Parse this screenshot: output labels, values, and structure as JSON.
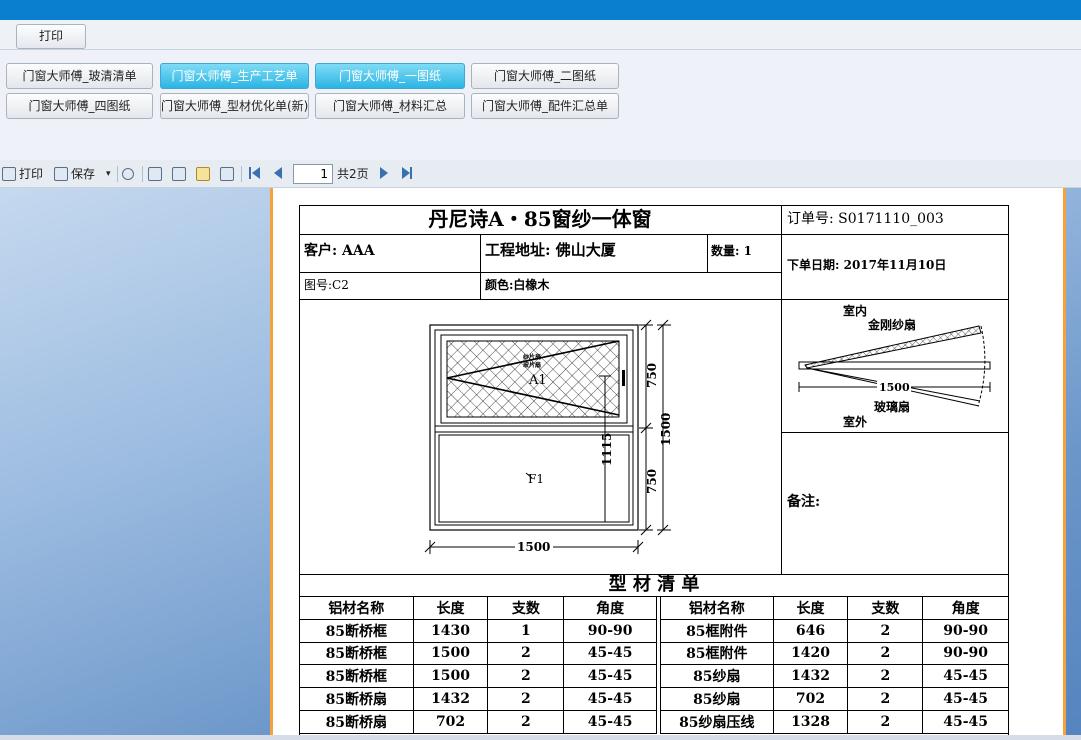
{
  "app": {
    "print_button": "打印"
  },
  "tabs": [
    {
      "label": "门窗大师傅_玻清清单",
      "active": false
    },
    {
      "label": "门窗大师傅_生产工艺单",
      "active": true
    },
    {
      "label": "门窗大师傅_一图纸",
      "active": true
    },
    {
      "label": "门窗大师傅_二图纸",
      "active": false
    },
    {
      "label": "门窗大师傅_四图纸",
      "active": false
    },
    {
      "label": "门窗大师傅_型材优化单(新)",
      "active": false
    },
    {
      "label": "门窗大师傅_材料汇总",
      "active": false
    },
    {
      "label": "门窗大师傅_配件汇总单",
      "active": false
    }
  ],
  "toolbar": {
    "print_label": "打印",
    "save_label": "保存",
    "page_value": "1",
    "total_pages": "共2页",
    "icons": [
      "printer-icon",
      "save-icon",
      "dropdown-icon",
      "find-icon",
      "single-page-icon",
      "zoom-icon",
      "edit-icon",
      "page-setup-icon",
      "first-page-icon",
      "prev-page-icon",
      "next-page-icon",
      "last-page-icon"
    ]
  },
  "report": {
    "title": "丹尼诗A・85窗纱一体窗",
    "order_label": "订单号: S0171110_003",
    "customer": "客户: AAA",
    "address": "工程地址: 佛山大厦",
    "quantity": "数量: 1",
    "order_date": "下单日期: 2017年11月10日",
    "drawing_no": "图号:C2",
    "color": "颜色:白橡木",
    "remark_label": "备注:",
    "section_title": "型 材 清 单",
    "drawing": {
      "sash_label": "A1",
      "fixed_label": "F1",
      "small_note_1": "纱片扇",
      "small_note_2": "玻片扇",
      "width_dim": "1500",
      "height_dim": "1500",
      "upper_dim": "750",
      "lower_dim": "750",
      "handle_dim": "1115"
    },
    "section_view": {
      "indoor": "室内",
      "screen_sash": "金刚纱扇",
      "width": "1500",
      "glass_sash": "玻璃扇",
      "outdoor": "室外"
    },
    "columns": [
      "铝材名称",
      "长度",
      "支数",
      "角度"
    ],
    "left_rows": [
      [
        "85断桥框",
        "1430",
        "1",
        "90-90"
      ],
      [
        "85断桥框",
        "1500",
        "2",
        "45-45"
      ],
      [
        "85断桥框",
        "1500",
        "2",
        "45-45"
      ],
      [
        "85断桥扇",
        "1432",
        "2",
        "45-45"
      ],
      [
        "85断桥扇",
        "702",
        "2",
        "45-45"
      ]
    ],
    "right_rows": [
      [
        "85框附件",
        "646",
        "2",
        "90-90"
      ],
      [
        "85框附件",
        "1420",
        "2",
        "90-90"
      ],
      [
        "85纱扇",
        "1432",
        "2",
        "45-45"
      ],
      [
        "85纱扇",
        "702",
        "2",
        "45-45"
      ],
      [
        "85纱扇压线",
        "1328",
        "2",
        "45-45"
      ]
    ]
  }
}
